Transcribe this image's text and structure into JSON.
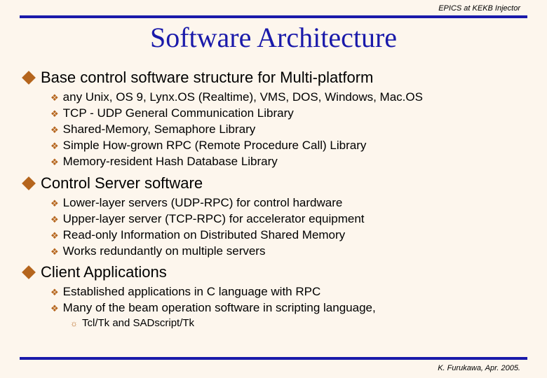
{
  "header": "EPICS at KEKB Injector",
  "title": "Software Architecture",
  "sections": [
    {
      "title": "Base control software structure for Multi-platform",
      "items": [
        "any Unix, OS 9, Lynx.OS (Realtime), VMS, DOS, Windows, Mac.OS",
        "TCP - UDP General Communication Library",
        "Shared-Memory, Semaphore Library",
        "Simple How-grown RPC (Remote Procedure Call) Library",
        "Memory-resident Hash Database Library"
      ]
    },
    {
      "title": "Control Server software",
      "items": [
        "Lower-layer servers (UDP-RPC) for control hardware",
        "Upper-layer server (TCP-RPC) for accelerator equipment",
        "Read-only Information on Distributed Shared Memory",
        "Works redundantly on multiple servers"
      ]
    },
    {
      "title": "Client Applications",
      "items": [
        "Established applications in C language with RPC",
        "Many of the beam operation software in scripting language,"
      ],
      "subitems": [
        "Tcl/Tk and SADscript/Tk"
      ]
    }
  ],
  "footer": "K. Furukawa, Apr. 2005."
}
